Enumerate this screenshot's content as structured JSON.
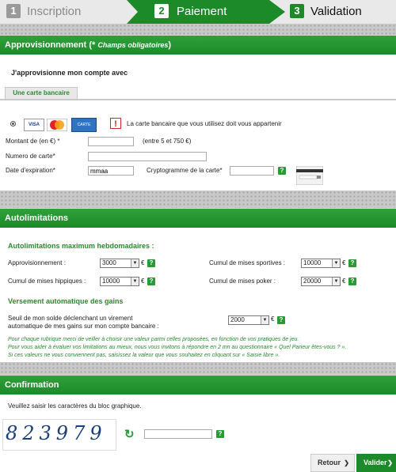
{
  "steps": [
    {
      "num": "1",
      "label": "Inscription"
    },
    {
      "num": "2",
      "label": "Paiement"
    },
    {
      "num": "3",
      "label": "Validation"
    }
  ],
  "approvisionnement": {
    "title": "Approvisionnement (",
    "star": "*",
    "req": "Champs obligatoires",
    "close": ")",
    "subtitle": "J'approvisionne mon compte avec",
    "tab": "Une carte bancaire",
    "warning": "La carte bancaire que vous utilisez doit vous appartenir",
    "card_blue": "CARTE BLEUE",
    "card_visa": "VISA",
    "montant_label": "Montant de (en €) *",
    "montant_hint": "(entre 5 et 750 €)",
    "numero_label": "Numero de carte*",
    "expiration_label": "Date d'expiration*",
    "expiration_value": "mmaa",
    "crypto_label": "Cryptogramme de la carte*"
  },
  "autolimitations": {
    "title": "Autolimitations",
    "sub1": "Autolimitations maximum hebdomadaires :",
    "appro_label": "Approvisionnement :",
    "appro_value": "3000",
    "sport_label": "Cumul de mises sportives :",
    "sport_value": "10000",
    "hippique_label": "Cumul de mises hippiques :",
    "hippique_value": "10000",
    "poker_label": "Cumul de mises poker :",
    "poker_value": "20000",
    "currency": "€",
    "sub2": "Versement automatique des gains",
    "seuil_line1": "Seuil de mon solde déclenchant un virement",
    "seuil_line2": "automatique de mes gains sur mon compte bancaire :",
    "seuil_value": "2000",
    "note1": "Pour chaque rubrique merci de veiller à choisir une valeur parmi celles proposées, en fonction de vos pratiques de jeu.",
    "note2": "Pour vous aider à évaluer vos limitations au mieux, nous vous invitons à répondre en 2 mn au questionnaire « Quel Parieur êtes-vous ? ».",
    "note3": "Si ces valeurs ne vous conviennent pas, saisissez la valeur que vous souhaitez en cliquant sur « Saisie libre »."
  },
  "confirmation": {
    "title": "Confirmation",
    "instruction": "Veuillez saisir les caractères du bloc graphique.",
    "captcha": "823979"
  },
  "buttons": {
    "retour": "Retour",
    "valider": "Valider"
  },
  "help": "?",
  "colors": {
    "green": "#1c8a28",
    "accent_green": "#2a8a2e",
    "warning_red": "#d6202a"
  }
}
